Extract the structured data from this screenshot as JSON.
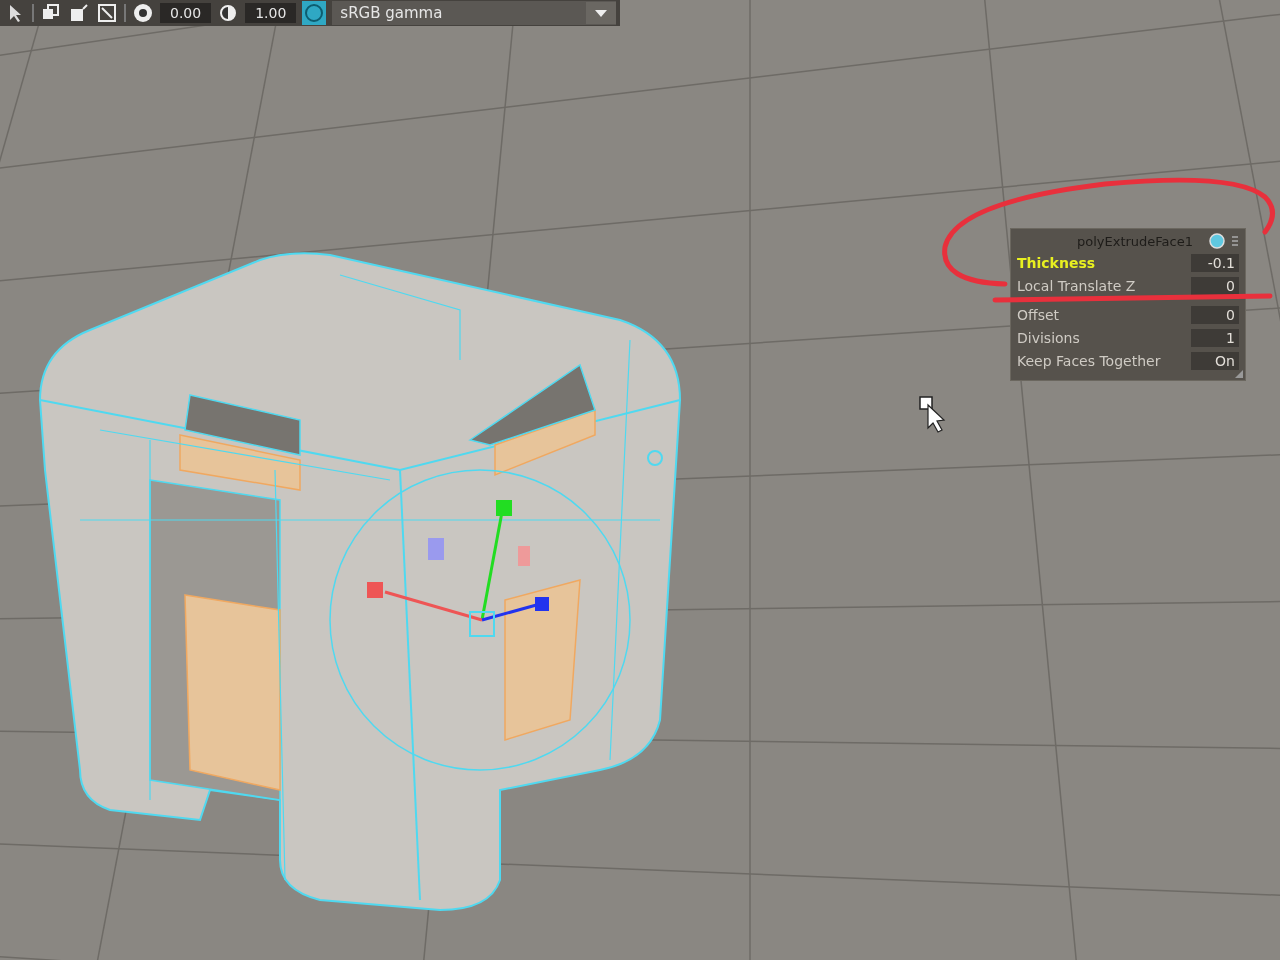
{
  "toolbar": {
    "exposure": "0.00",
    "gamma": "1.00",
    "view_transform": "sRGB gamma"
  },
  "attribute_panel": {
    "title": "polyExtrudeFace1",
    "rows": [
      {
        "label": "Thickness",
        "value": "-0.1",
        "highlighted": true
      },
      {
        "label": "Local Translate Z",
        "value": "0",
        "highlighted": false
      },
      {
        "label": "Offset",
        "value": "0",
        "highlighted": false
      },
      {
        "label": "Divisions",
        "value": "1",
        "highlighted": false
      },
      {
        "label": "Keep Faces Together",
        "value": "On",
        "highlighted": false
      }
    ]
  }
}
